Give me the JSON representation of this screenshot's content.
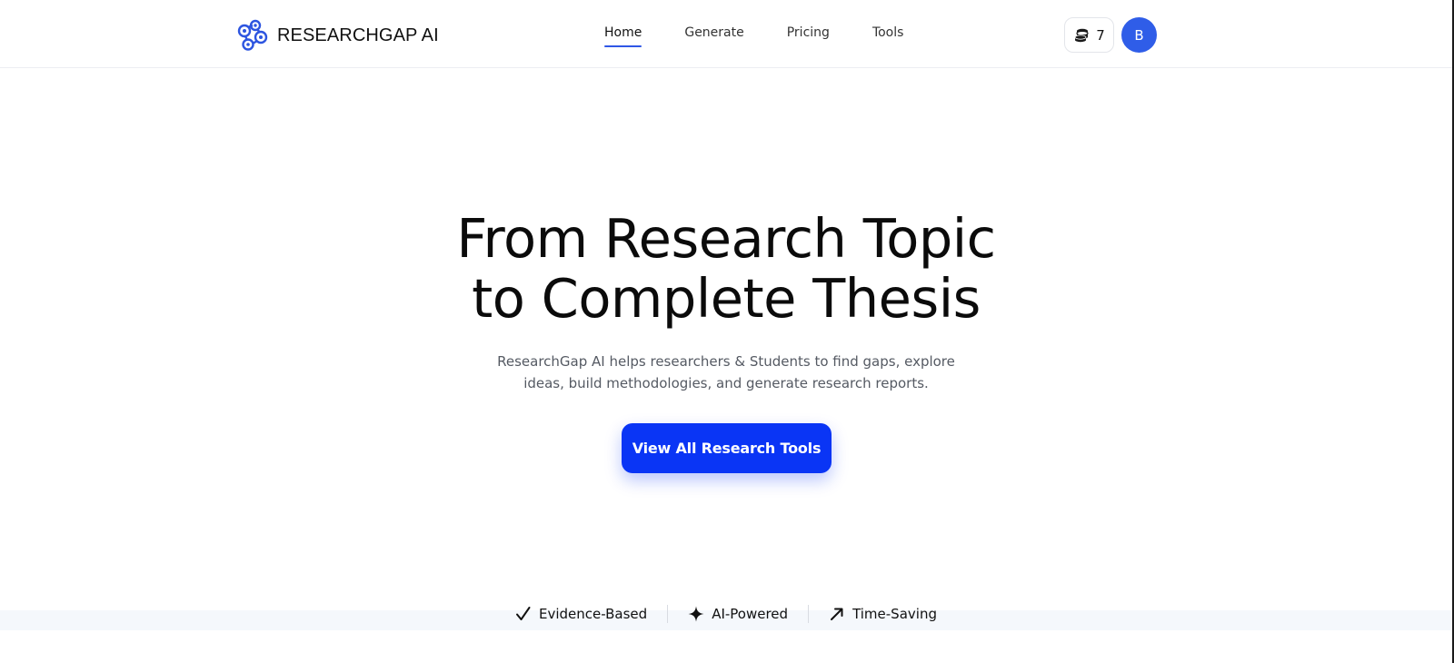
{
  "brand": {
    "name": "RESEARCHGAP AI",
    "accent": "#2f57e6"
  },
  "nav": {
    "items": [
      {
        "label": "Home",
        "active": true
      },
      {
        "label": "Generate",
        "active": false
      },
      {
        "label": "Pricing",
        "active": false
      },
      {
        "label": "Tools",
        "active": false
      }
    ]
  },
  "account": {
    "credits": "7",
    "credits_icon": "coins-stack-icon",
    "avatar_initial": "B",
    "avatar_color": "#2f5de8"
  },
  "hero": {
    "title_line1": "From Research Topic",
    "title_line2": "to Complete Thesis",
    "subtitle_line1": "ResearchGap AI helps researchers & Students to find gaps, explore",
    "subtitle_line2": "ideas, build methodologies, and generate research reports.",
    "cta_label": "View All Research Tools",
    "cta_color": "#0a35f5"
  },
  "features": [
    {
      "icon": "checkmark-icon",
      "label": "Evidence-Based"
    },
    {
      "icon": "sparkle-icon",
      "label": "AI-Powered"
    },
    {
      "icon": "trend-arrow-icon",
      "label": "Time-Saving"
    }
  ]
}
